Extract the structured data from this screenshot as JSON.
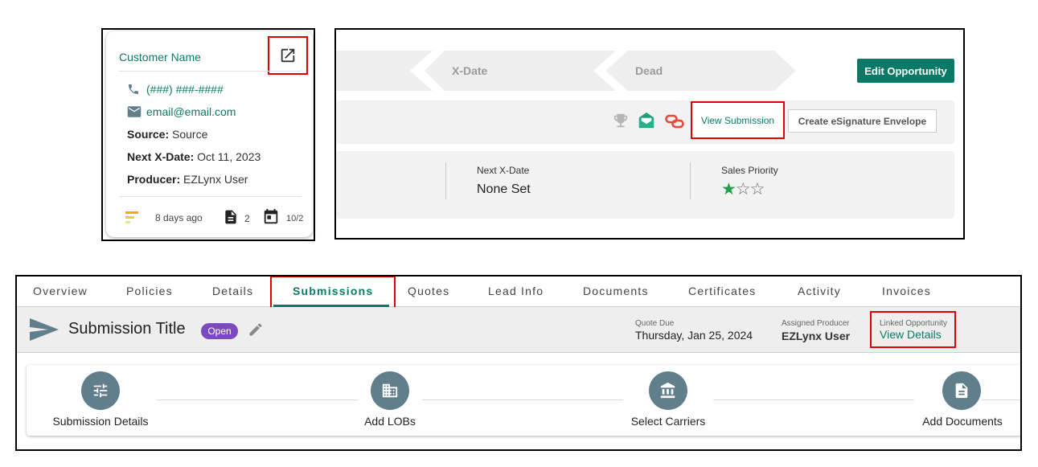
{
  "customer_card": {
    "name": "Customer Name",
    "phone": "(###) ###-####",
    "email": "email@email.com",
    "source_label": "Source:",
    "source_value": "Source",
    "next_xdate_label": "Next X-Date:",
    "next_xdate_value": "Oct 11, 2023",
    "producer_label": "Producer:",
    "producer_value": "EZLynx User",
    "footer": {
      "age": "8 days ago",
      "doc_count": "2",
      "date": "10/2"
    },
    "icons": {
      "external_link": "open-in-new-icon",
      "phone": "phone-icon",
      "email": "email-icon",
      "priority": "priority-bars-icon",
      "document": "document-icon",
      "calendar": "calendar-icon"
    }
  },
  "opportunity": {
    "stages": [
      "X-Date",
      "Dead"
    ],
    "edit_button": "Edit Opportunity",
    "view_submission": "View Submission",
    "esignature_button": "Create eSignature Envelope",
    "next_xdate_label": "Next X-Date",
    "next_xdate_value": "None Set",
    "sales_priority_label": "Sales Priority",
    "sales_priority_rating": 1,
    "sales_priority_max": 3,
    "stars_text": {
      "filled": "★",
      "empty": "☆☆"
    },
    "icons": [
      "trophy-icon",
      "email-open-icon",
      "link-icon"
    ]
  },
  "submission": {
    "tabs": [
      "Overview",
      "Policies",
      "Details",
      "Submissions",
      "Quotes",
      "Lead Info",
      "Documents",
      "Certificates",
      "Activity",
      "Invoices"
    ],
    "active_tab": "Submissions",
    "title": "Submission Title",
    "status_badge": "Open",
    "quote_due_label": "Quote Due",
    "quote_due_value": "Thursday, Jan 25, 2024",
    "assigned_producer_label": "Assigned Producer",
    "assigned_producer_value": "EZLynx User",
    "linked_opportunity_label": "Linked Opportunity",
    "linked_opportunity_value": "View Details",
    "steps": [
      "Submission Details",
      "Add LOBs",
      "Select Carriers",
      "Add Documents"
    ],
    "colors": {
      "accent": "#0a7a66",
      "badge": "#7b49c2",
      "step_circle": "#607e8c",
      "highlight": "#e00000"
    }
  }
}
